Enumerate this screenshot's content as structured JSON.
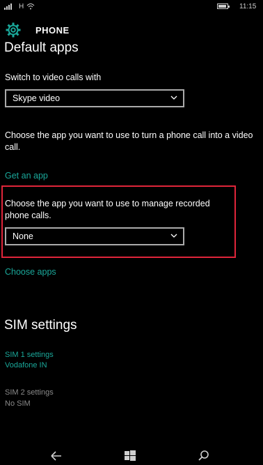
{
  "status_bar": {
    "network": "H",
    "time": "11:15"
  },
  "header": {
    "title": "PHONE",
    "icon": "gear-icon"
  },
  "default_apps": {
    "section_title": "Default apps",
    "video_label": "Switch to video calls with",
    "video_selected": "Skype video",
    "video_description": "Choose the app you want to use to turn a phone call into a video call.",
    "get_app_link": "Get an app",
    "recording_label": "Choose the app you want to use to manage recorded phone calls.",
    "recording_selected": "None",
    "choose_apps_link": "Choose apps"
  },
  "sim_settings": {
    "section_title": "SIM settings",
    "sim1_title": "SIM 1 settings",
    "sim1_value": "Vodafone IN",
    "sim2_title": "SIM 2 settings",
    "sim2_value": "No SIM"
  },
  "colors": {
    "accent": "#1aa89a",
    "highlight": "#e0253a",
    "background": "#000000"
  },
  "navbar": {
    "back_icon": "back-arrow-icon",
    "start_icon": "windows-start-icon",
    "search_icon": "search-icon"
  }
}
